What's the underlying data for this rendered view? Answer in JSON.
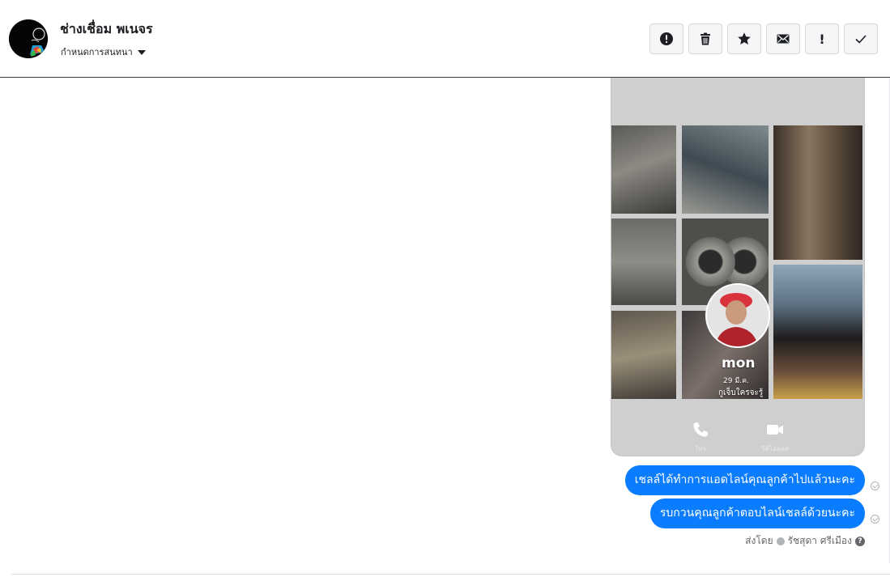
{
  "header": {
    "contact_name": "ช่างเชื่อม พเนจร",
    "assign_label": "กำหนดการสนทนา",
    "avatar_icon": "contact-avatar",
    "actions": [
      {
        "name": "spam-button",
        "icon": "alert-circle-icon"
      },
      {
        "name": "delete-button",
        "icon": "trash-icon"
      },
      {
        "name": "star-button",
        "icon": "star-icon"
      },
      {
        "name": "mark-unread-button",
        "icon": "envelope-icon"
      },
      {
        "name": "follow-up-button",
        "icon": "exclamation-icon"
      },
      {
        "name": "done-button",
        "icon": "check-icon"
      }
    ]
  },
  "conversation": {
    "shared_profile": {
      "name": "mon",
      "meta": "29 มี.ค.",
      "status": "กูเจ็บใครจะรู้",
      "call_label": "โทร",
      "video_label": "วิดีโอคอล"
    },
    "messages": [
      {
        "text": "เชลล์ได้ทำการแอดไลน์คุณลูกค้าไปแล้วนะคะ"
      },
      {
        "text": "รบกวนคุณลูกค้าตอบไลน์เชลล์ด้วยนะคะ"
      }
    ],
    "sent_by_label": "ส่งโดย",
    "sender_name": "รัชสุดา ศรีเมือง"
  },
  "colors": {
    "bubble": "#0a7cff",
    "header_border": "#3a3b3c",
    "button_bg": "#f5f6f7"
  }
}
